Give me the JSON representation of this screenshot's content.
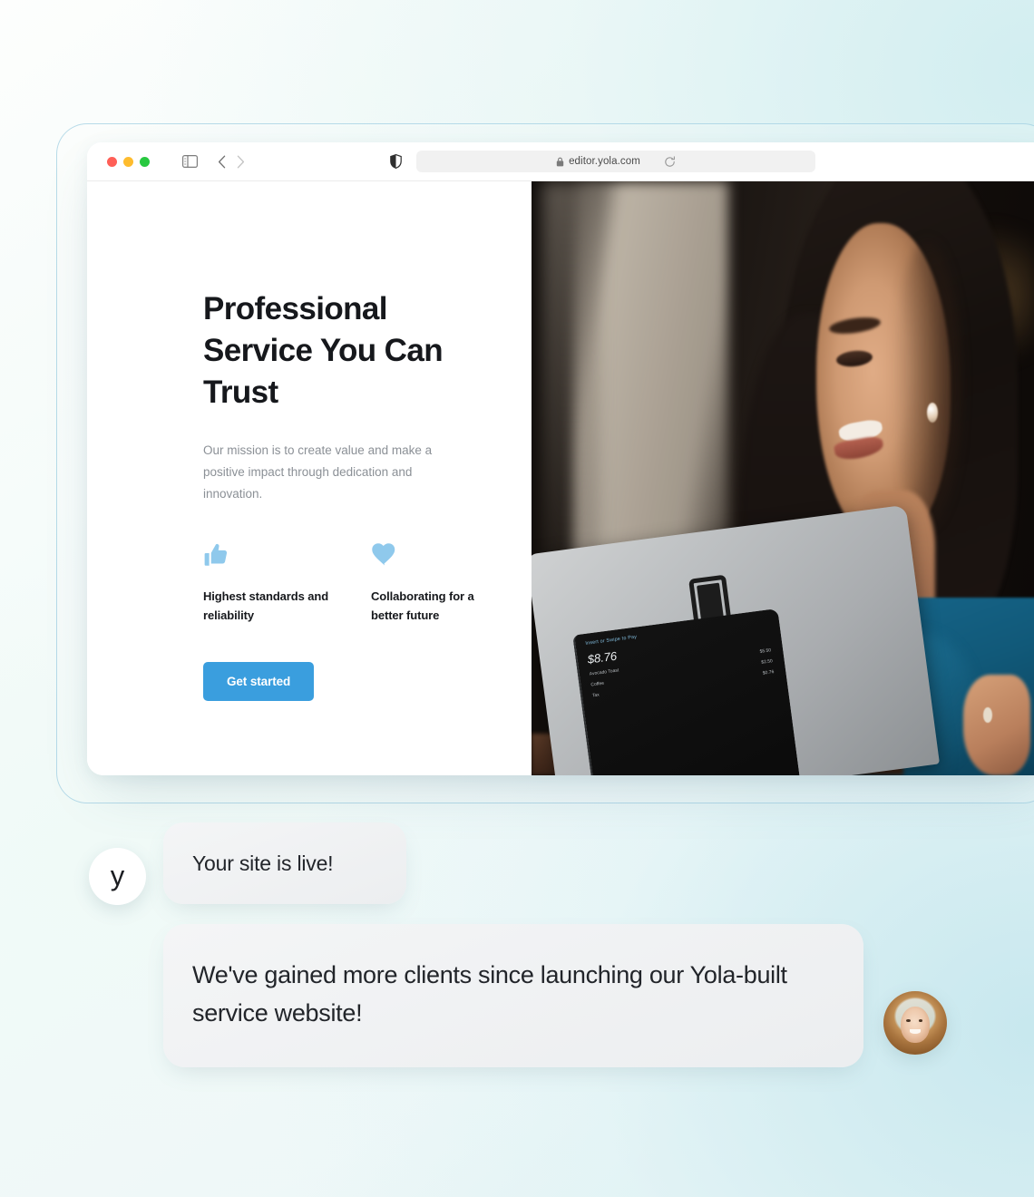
{
  "browser": {
    "traffic_lights": [
      "close-red",
      "minimize-yellow",
      "maximize-green"
    ],
    "sidebar_icon": "sidebar-toggle-icon",
    "back_icon": "chevron-left-icon",
    "forward_icon": "chevron-right-icon",
    "shield_icon": "privacy-shield-icon",
    "lock_icon": "lock-icon",
    "url": "editor.yola.com",
    "reload_icon": "reload-icon",
    "colors": {
      "red": "#ff5f57",
      "yellow": "#febc2e",
      "green": "#28c840",
      "urlbar_bg": "#f1f1f1"
    }
  },
  "hero": {
    "title": "Professional Service You Can Trust",
    "subtitle": "Our mission is to create value and make a positive impact through dedication and innovation.",
    "features": [
      {
        "icon": "thumbs-up-icon",
        "label": "Highest standards and reliability"
      },
      {
        "icon": "heart-icon",
        "label": "Collaborating for a better future"
      }
    ],
    "cta_label": "Get started",
    "colors": {
      "cta_bg": "#3a9ede",
      "icon_blue": "#8fc9ec",
      "heading": "#16181c",
      "body_text": "#8b9096"
    },
    "photo": {
      "alt": "Smiling woman in a blue top holding a Square POS card reader terminal",
      "pos_terminal": {
        "prompt": "Insert or Swipe to Pay",
        "total": "$8.76",
        "line_items": [
          {
            "name": "Avocado Toast",
            "price": "$5.50"
          },
          {
            "name": "Coffee",
            "price": "$2.50"
          },
          {
            "name": "Tax",
            "price": "$0.76"
          }
        ]
      }
    }
  },
  "chat": {
    "messages": [
      {
        "avatar": "yola-logo-avatar",
        "avatar_letter": "y",
        "text": "Your site is live!"
      },
      {
        "avatar": "customer-photo-avatar",
        "text": "We've gained more clients since launching our Yola-built service website!"
      }
    ]
  },
  "page": {
    "background_colors": [
      "#fdfefd",
      "#f4fbf9",
      "#eaf6f6",
      "#e2f2f3"
    ],
    "frame_border": "#a0cfe1"
  }
}
